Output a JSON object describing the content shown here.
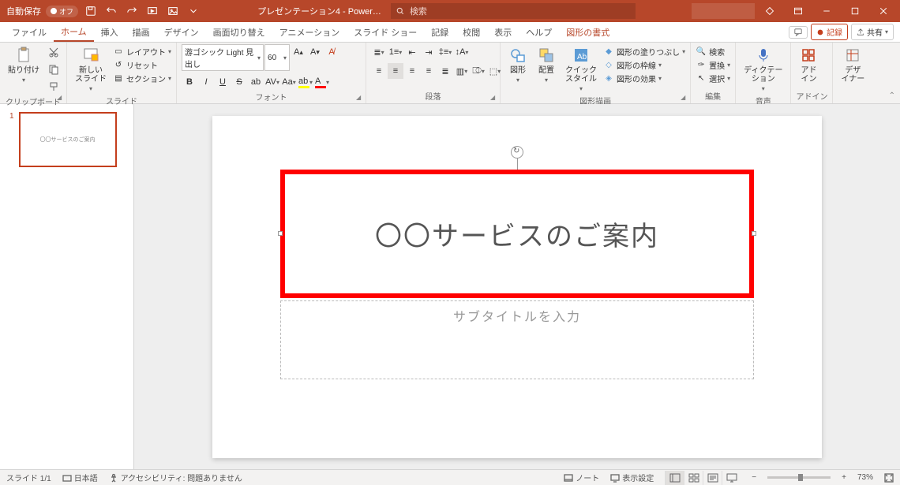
{
  "titlebar": {
    "autosave_label": "自動保存",
    "autosave_state": "オフ",
    "doc_title": "プレゼンテーション4 - Power…",
    "search_placeholder": "検索"
  },
  "tabs": {
    "file": "ファイル",
    "home": "ホーム",
    "insert": "挿入",
    "draw": "描画",
    "design": "デザイン",
    "transitions": "画面切り替え",
    "animations": "アニメーション",
    "slideshow": "スライド ショー",
    "record": "記録",
    "review": "校閲",
    "view": "表示",
    "help": "ヘルプ",
    "shape_format": "図形の書式",
    "record_btn": "記録",
    "share_btn": "共有"
  },
  "ribbon": {
    "clipboard": {
      "paste": "貼り付け",
      "label": "クリップボード"
    },
    "slides": {
      "new_slide": "新しい\nスライド",
      "layout": "レイアウト",
      "reset": "リセット",
      "section": "セクション",
      "label": "スライド"
    },
    "font": {
      "name": "游ゴシック Light 見出し",
      "size": "60",
      "label": "フォント"
    },
    "paragraph": {
      "label": "段落"
    },
    "drawing": {
      "shapes": "図形",
      "arrange": "配置",
      "quick_styles": "クイック\nスタイル",
      "shape_fill": "図形の塗りつぶし",
      "shape_outline": "図形の枠線",
      "shape_effects": "図形の効果",
      "label": "図形描画"
    },
    "editing": {
      "find": "検索",
      "replace": "置換",
      "select": "選択",
      "label": "編集"
    },
    "voice": {
      "dictate": "ディクテー\nション",
      "label": "音声"
    },
    "addins": {
      "addins": "アド\nイン",
      "label": "アドイン"
    },
    "designer": {
      "designer": "デザ\nイナー"
    }
  },
  "thumbnail": {
    "number": "1",
    "preview_text": "〇〇サービスのご案内"
  },
  "slide": {
    "title": "〇〇サービスのご案内",
    "subtitle": "サブタイトルを入力"
  },
  "statusbar": {
    "slide_counter": "スライド 1/1",
    "language": "日本語",
    "accessibility": "アクセシビリティ: 問題ありません",
    "notes": "ノート",
    "display_settings": "表示設定",
    "zoom": "73%"
  }
}
